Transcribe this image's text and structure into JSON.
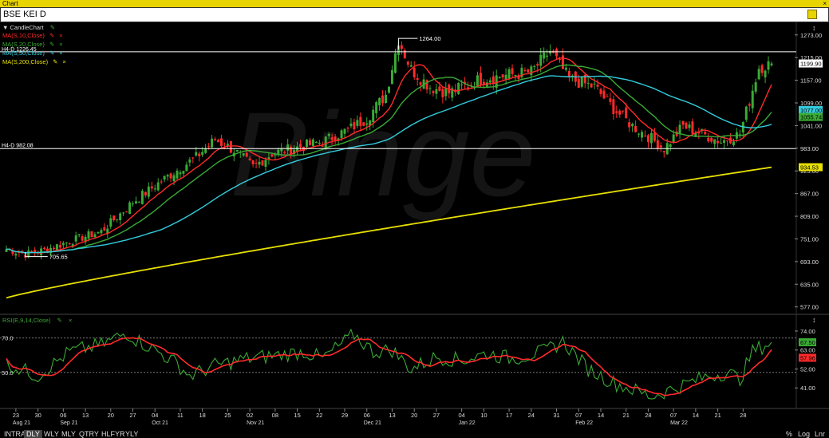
{
  "window": {
    "title": "Chart",
    "close": "×"
  },
  "symbol": {
    "text": "BSE KEI D"
  },
  "legend": {
    "candle": {
      "label": "▼ CandleChart",
      "color": "#3aaa35"
    },
    "ma": [
      {
        "label": "MA(S,10,Close)",
        "color": "#ff2a2a"
      },
      {
        "label": "MA(S,20,Close)",
        "color": "#3aaa35"
      },
      {
        "label": "MA(S,50,Close)",
        "color": "#33ccdd"
      },
      {
        "label": "MA(S,200,Close)",
        "color": "#e8e000"
      }
    ],
    "rsi": {
      "label": "RSI(E,9,14,Close)",
      "color": "#3aaa35"
    }
  },
  "annotations": {
    "high": "1264.00",
    "low": "705.65",
    "hline_label": "H4-D 982.08",
    "hline_value": 982.08,
    "upper_line_value": 1230,
    "upper_line_label": "H4-D 1226.45"
  },
  "price_axis": {
    "ticks": [
      "1273.00",
      "1215.00",
      "1157.00",
      "1099.00",
      "1041.00",
      "983.00",
      "925.00",
      "867.00",
      "809.00",
      "751.00",
      "693.00",
      "635.00",
      "577.00"
    ],
    "badges": [
      {
        "text": "1199.90",
        "value": 1199.9,
        "bg": "#ffffff",
        "fg": "#000000"
      },
      {
        "text": "1077.00",
        "value": 1081,
        "bg": "#33ccdd",
        "fg": "#000000"
      },
      {
        "text": "1055.74",
        "value": 1063,
        "bg": "#3aaa35",
        "fg": "#000000"
      },
      {
        "text": "934.53",
        "value": 934.53,
        "bg": "#e8e000",
        "fg": "#000000"
      }
    ]
  },
  "rsi_axis": {
    "ticks": [
      "74.00",
      "63.00",
      "52.00",
      "41.00"
    ],
    "levels": [
      {
        "text": "70.0",
        "value": 70
      },
      {
        "text": "50.0",
        "value": 50
      }
    ],
    "badges": [
      {
        "text": "67.50",
        "value": 67.5,
        "bg": "#3aaa35",
        "fg": "#000000"
      },
      {
        "text": "57.96",
        "value": 58.5,
        "bg": "#ff2a2a",
        "fg": "#000000"
      }
    ]
  },
  "date_axis": {
    "days": [
      "23",
      "30",
      "06",
      "13",
      "20",
      "27",
      "04",
      "11",
      "18",
      "25",
      "02",
      "08",
      "15",
      "22",
      "29",
      "06",
      "13",
      "20",
      "27",
      "04",
      "10",
      "17",
      "24",
      "31",
      "07",
      "14",
      "21",
      "28",
      "07",
      "14",
      "21",
      "28"
    ],
    "months": [
      {
        "text": "Aug 21",
        "at": 0
      },
      {
        "text": "Sep 21",
        "at": 2
      },
      {
        "text": "Oct 21",
        "at": 6
      },
      {
        "text": "Nov 21",
        "at": 10
      },
      {
        "text": "Dec 21",
        "at": 15
      },
      {
        "text": "Jan 22",
        "at": 19
      },
      {
        "text": "Feb 22",
        "at": 24
      },
      {
        "text": "Mar 22",
        "at": 28
      }
    ]
  },
  "timeframes": [
    "INTRA",
    "DLY",
    "WLY",
    "MLY",
    "QTRY",
    "HLFYR",
    "YLY"
  ],
  "active_timeframe": "DLY",
  "bottom_right": [
    "%",
    "Log",
    "Lnr"
  ],
  "watermark": "Binge",
  "colors": {
    "up": "#3aaa35",
    "down": "#ff2a2a",
    "bg": "#000000",
    "axis_text": "#dddddd"
  },
  "chart_data": {
    "type": "candlestick",
    "title": "BSE KEI D",
    "y_range": [
      560,
      1295
    ],
    "rsi_range": [
      30,
      80
    ],
    "anchors": {
      "close": [
        [
          0,
          725
        ],
        [
          6,
          712
        ],
        [
          12,
          722
        ],
        [
          20,
          745
        ],
        [
          30,
          770
        ],
        [
          40,
          845
        ],
        [
          50,
          905
        ],
        [
          60,
          960
        ],
        [
          66,
          1005
        ],
        [
          72,
          978
        ],
        [
          78,
          935
        ],
        [
          84,
          970
        ],
        [
          92,
          985
        ],
        [
          100,
          1000
        ],
        [
          108,
          1030
        ],
        [
          114,
          1060
        ],
        [
          120,
          1120
        ],
        [
          124,
          1262
        ],
        [
          128,
          1185
        ],
        [
          134,
          1140
        ],
        [
          140,
          1125
        ],
        [
          150,
          1160
        ],
        [
          160,
          1172
        ],
        [
          166,
          1178
        ],
        [
          172,
          1232
        ],
        [
          178,
          1160
        ],
        [
          186,
          1140
        ],
        [
          192,
          1085
        ],
        [
          198,
          1040
        ],
        [
          204,
          1008
        ],
        [
          208,
          982
        ],
        [
          214,
          1040
        ],
        [
          220,
          1020
        ],
        [
          226,
          1000
        ],
        [
          232,
          1020
        ],
        [
          238,
          1190
        ],
        [
          242,
          1199.9
        ]
      ],
      "rsi": [
        [
          0,
          55
        ],
        [
          10,
          48
        ],
        [
          20,
          62
        ],
        [
          30,
          66
        ],
        [
          38,
          73
        ],
        [
          42,
          68
        ],
        [
          48,
          62
        ],
        [
          54,
          55
        ],
        [
          58,
          48
        ],
        [
          66,
          54
        ],
        [
          76,
          58
        ],
        [
          86,
          60
        ],
        [
          94,
          62
        ],
        [
          100,
          58
        ],
        [
          110,
          72
        ],
        [
          116,
          62
        ],
        [
          122,
          63
        ],
        [
          128,
          52
        ],
        [
          136,
          59
        ],
        [
          144,
          57
        ],
        [
          152,
          61
        ],
        [
          160,
          58
        ],
        [
          170,
          62
        ],
        [
          176,
          68
        ],
        [
          184,
          52
        ],
        [
          192,
          44
        ],
        [
          198,
          40
        ],
        [
          204,
          36
        ],
        [
          210,
          40
        ],
        [
          216,
          44
        ],
        [
          222,
          48
        ],
        [
          228,
          50
        ],
        [
          232,
          46
        ],
        [
          236,
          62
        ],
        [
          240,
          66
        ],
        [
          242,
          67.5
        ]
      ]
    },
    "overlays": [
      {
        "name": "MA(S,10,Close)",
        "period": 10
      },
      {
        "name": "MA(S,20,Close)",
        "period": 20
      },
      {
        "name": "MA(S,50,Close)",
        "period": 50
      },
      {
        "name": "MA(S,200,Close)",
        "from": 600,
        "to": 934.53
      }
    ]
  }
}
